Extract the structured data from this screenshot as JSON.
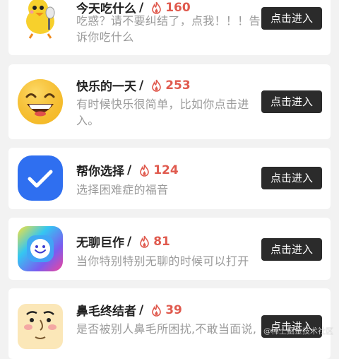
{
  "apps": [
    {
      "title": "今天吃什么",
      "slash": "/",
      "count": "160",
      "description": "吃惑？请不要纠结了，点我！！！告诉你吃什么",
      "button": "点击进入",
      "icon": "chicken-chef-icon"
    },
    {
      "title": "快乐的一天",
      "slash": "/",
      "count": "253",
      "description": "有时候快乐很简单，比如你点击进入。",
      "button": "点击进入",
      "icon": "smiley-face-icon"
    },
    {
      "title": "帮你选择",
      "slash": "/",
      "count": "124",
      "description": "选择困难症的福音",
      "button": "点击进入",
      "icon": "checkmark-icon"
    },
    {
      "title": "无聊巨作",
      "slash": "/",
      "count": "81",
      "description": "当你特别特别无聊的时候可以打开",
      "button": "点击进入",
      "icon": "gradient-smiley-icon"
    },
    {
      "title": "鼻毛终结者",
      "slash": "/",
      "count": "39",
      "description": "是否被别人鼻毛所困扰,不敢当面说,",
      "button": "点击进入",
      "icon": "cartoon-face-icon"
    }
  ],
  "colors": {
    "accent_count": "#e05a4e",
    "button_bg": "#2b2b2b",
    "page_bg": "#f2f2f2"
  },
  "watermark": "@稀土掘金技术社区"
}
